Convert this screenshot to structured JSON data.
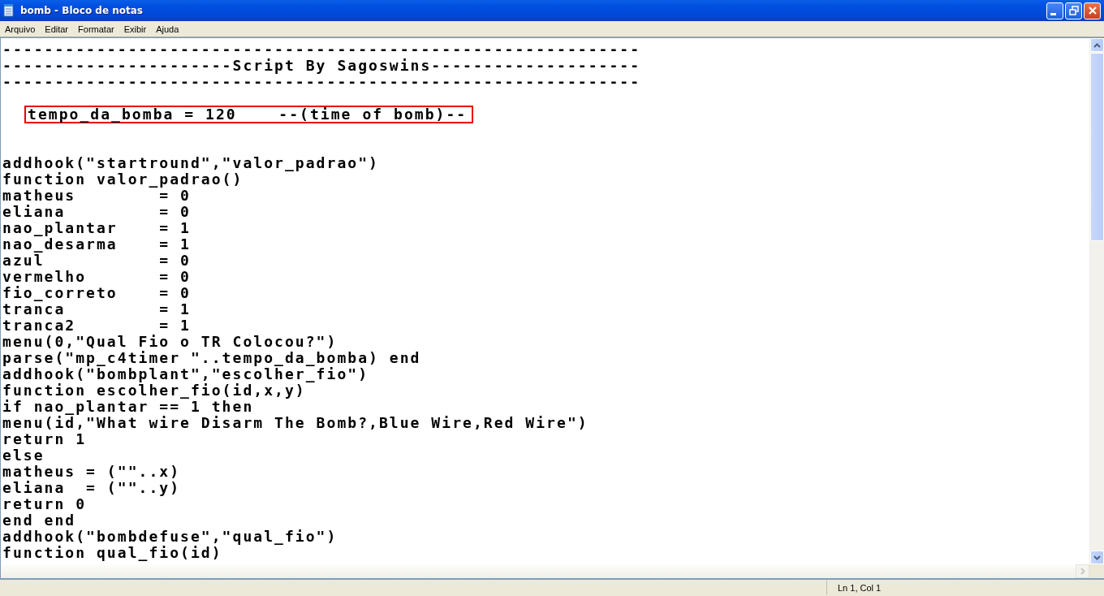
{
  "window": {
    "title": "bomb - Bloco de notas"
  },
  "menu": [
    "Arquivo",
    "Editar",
    "Formatar",
    "Exibir",
    "Ajuda"
  ],
  "editor": {
    "lines": [
      {
        "kind": "code",
        "text": "-------------------------------------------------------------"
      },
      {
        "kind": "code",
        "text": "----------------------Script By Sagoswins--------------------"
      },
      {
        "kind": "code",
        "text": "-------------------------------------------------------------"
      },
      {
        "kind": "blank"
      },
      {
        "kind": "code",
        "text": "tempo_da_bomba = 120    --(time of bomb)--",
        "annotated": true
      },
      {
        "kind": "blank"
      },
      {
        "kind": "blank"
      },
      {
        "kind": "code",
        "text": "addhook(\"startround\",\"valor_padrao\")"
      },
      {
        "kind": "code",
        "text": "function valor_padrao()"
      },
      {
        "kind": "code",
        "text": "matheus        = 0"
      },
      {
        "kind": "code",
        "text": "eliana         = 0"
      },
      {
        "kind": "code",
        "text": "nao_plantar    = 1"
      },
      {
        "kind": "code",
        "text": "nao_desarma    = 1"
      },
      {
        "kind": "code",
        "text": "azul           = 0"
      },
      {
        "kind": "code",
        "text": "vermelho       = 0"
      },
      {
        "kind": "code",
        "text": "fio_correto    = 0"
      },
      {
        "kind": "code",
        "text": "tranca         = 1"
      },
      {
        "kind": "code",
        "text": "tranca2        = 1"
      },
      {
        "kind": "code",
        "text": "menu(0,\"Qual Fio o TR Colocou?\")"
      },
      {
        "kind": "code",
        "text": "parse(\"mp_c4timer \"..tempo_da_bomba) end"
      },
      {
        "kind": "code",
        "text": "addhook(\"bombplant\",\"escolher_fio\")"
      },
      {
        "kind": "code",
        "text": "function escolher_fio(id,x,y)"
      },
      {
        "kind": "code",
        "text": "if nao_plantar == 1 then"
      },
      {
        "kind": "code",
        "text": "menu(id,\"What wire Disarm The Bomb?,Blue Wire,Red Wire\")"
      },
      {
        "kind": "code",
        "text": "return 1"
      },
      {
        "kind": "code",
        "text": "else"
      },
      {
        "kind": "code",
        "text": "matheus = (\"\"..x)"
      },
      {
        "kind": "code",
        "text": "eliana  = (\"\"..y)"
      },
      {
        "kind": "code",
        "text": "return 0"
      },
      {
        "kind": "code",
        "text": "end end"
      },
      {
        "kind": "code",
        "text": "addhook(\"bombdefuse\",\"qual_fio\")"
      },
      {
        "kind": "code",
        "text": "function qual_fio(id)"
      }
    ]
  },
  "status_bar": {
    "position": "Ln 1, Col 1"
  }
}
